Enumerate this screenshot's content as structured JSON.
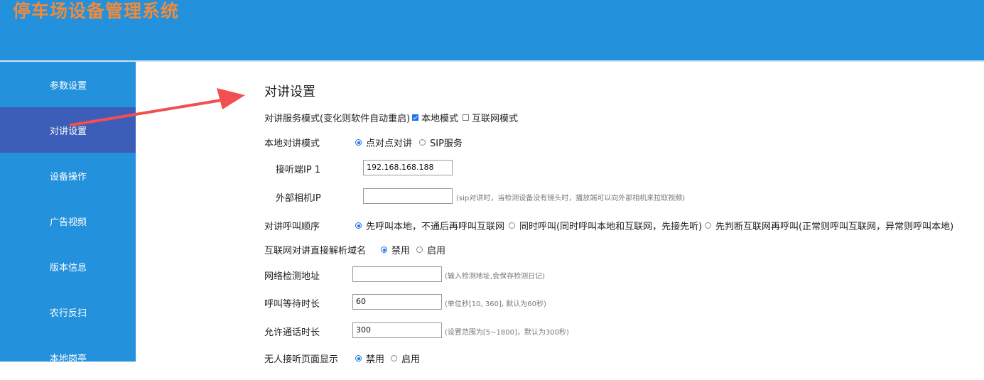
{
  "header": {
    "title": "停车场设备管理系统"
  },
  "sidebar": {
    "items": [
      {
        "label": "参数设置"
      },
      {
        "label": "对讲设置"
      },
      {
        "label": "设备操作"
      },
      {
        "label": "广告视频"
      },
      {
        "label": "版本信息"
      },
      {
        "label": "农行反扫"
      },
      {
        "label": "本地岗亭"
      }
    ],
    "active_index": 1
  },
  "form": {
    "title": "对讲设置",
    "service_mode": {
      "label": "对讲服务模式(变化则软件自动重启)",
      "options": [
        "本地模式",
        "互联网模式"
      ],
      "checked": [
        true,
        false
      ]
    },
    "local_mode": {
      "label": "本地对讲模式",
      "options": [
        "点对点对讲",
        "SIP服务"
      ],
      "selected": 0
    },
    "receiver_ip": {
      "label": "接听端IP 1",
      "value": "192.168.168.188"
    },
    "external_camera_ip": {
      "label": "外部相机IP",
      "value": "",
      "hint": "(sip对讲时，当检测设备没有镜头时，播放端可以向外部相机来拉取视频)"
    },
    "call_order": {
      "label": "对讲呼叫顺序",
      "options": [
        "先呼叫本地，不通后再呼叫互联网",
        "同时呼叫(同时呼叫本地和互联网，先接先听)",
        "先判断互联网再呼叫(正常则呼叫互联网，异常则呼叫本地)"
      ],
      "selected": 0
    },
    "direct_resolve": {
      "label": "互联网对讲直接解析域名",
      "options": [
        "禁用",
        "启用"
      ],
      "selected": 0
    },
    "network_check": {
      "label": "网络检测地址",
      "value": "",
      "hint": "(输入检测地址,会保存检测日记)"
    },
    "call_wait": {
      "label": "呼叫等待时长",
      "value": "60",
      "hint": "(单位秒[10, 360], 默认为60秒)"
    },
    "talk_duration": {
      "label": "允许通话时长",
      "value": "300",
      "hint": "(设置范围为[5~1800]，默认为300秒)"
    },
    "no_answer_page": {
      "label": "无人接听页面显示",
      "options": [
        "禁用",
        "启用"
      ],
      "selected": 0
    }
  },
  "colors": {
    "header_bg": "#2391dc",
    "sidebar_active": "#3d5eb8",
    "title_color": "#f08a3c",
    "arrow": "#f05050"
  }
}
